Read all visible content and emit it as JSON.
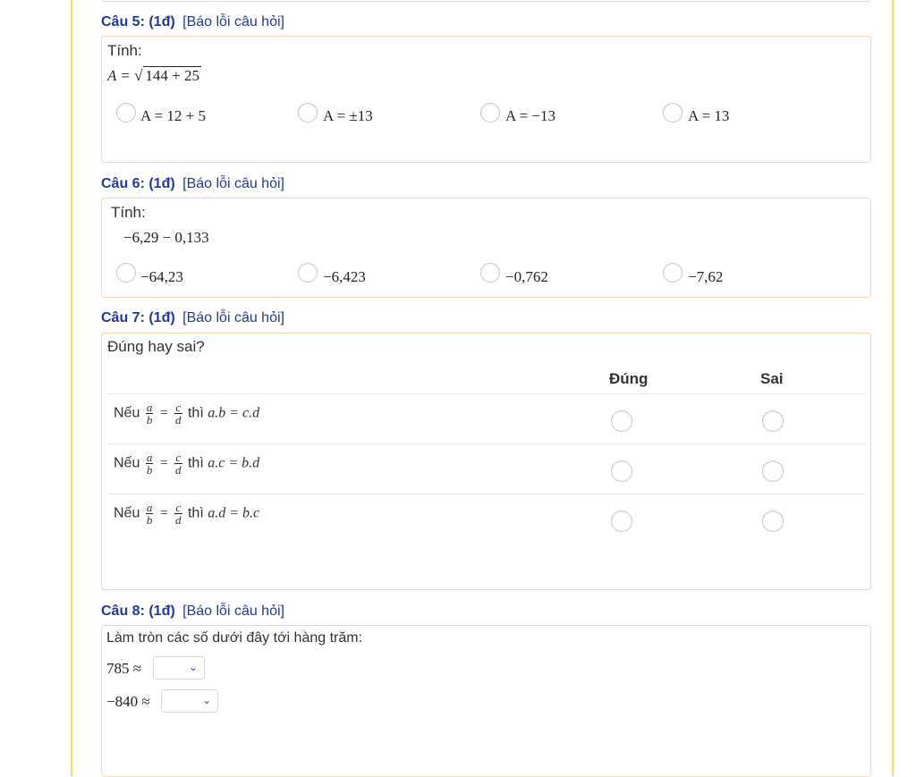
{
  "report_label": "[Báo lỗi câu hỏi]",
  "q5": {
    "number": "Câu 5: (1đ)",
    "prompt": "Tính:",
    "expr_lhs": "A = ",
    "expr_radicand": "144 + 25",
    "options": [
      "A = 12 + 5",
      "A = ±13",
      "A = −13",
      "A = 13"
    ]
  },
  "q6": {
    "number": "Câu 6: (1đ)",
    "prompt": "Tính:",
    "expr": "−6,29 − 0,133",
    "options": [
      "−64,23",
      "−6,423",
      "−0,762",
      "−7,62"
    ]
  },
  "q7": {
    "number": "Câu 7: (1đ)",
    "prompt": "Đúng hay sai?",
    "col_true": "Đúng",
    "col_false": "Sai",
    "statements": [
      {
        "prefix": "Nếu",
        "then": "thì",
        "conclusion": "a.b = c.d"
      },
      {
        "prefix": "Nếu",
        "then": "thì",
        "conclusion": "a.c = b.d"
      },
      {
        "prefix": "Nếu",
        "then": "thì",
        "conclusion": "a.d = b.c"
      }
    ],
    "frac_left": {
      "num": "a",
      "den": "b"
    },
    "frac_right": {
      "num": "c",
      "den": "d"
    },
    "eq": "="
  },
  "q8": {
    "number": "Câu 8: (1đ)",
    "prompt": "Làm tròn các số dưới đây tới hàng trăm:",
    "items": [
      {
        "label": "785 ≈",
        "selected": ""
      },
      {
        "label": "−840 ≈",
        "selected": ""
      }
    ]
  },
  "colors": {
    "heading": "#23399a",
    "card_border": "#f6d8b0",
    "page_border": "#f5dd5c"
  },
  "icons": {
    "select_arrow": "chevron-down-icon",
    "radio": "radio-button"
  }
}
